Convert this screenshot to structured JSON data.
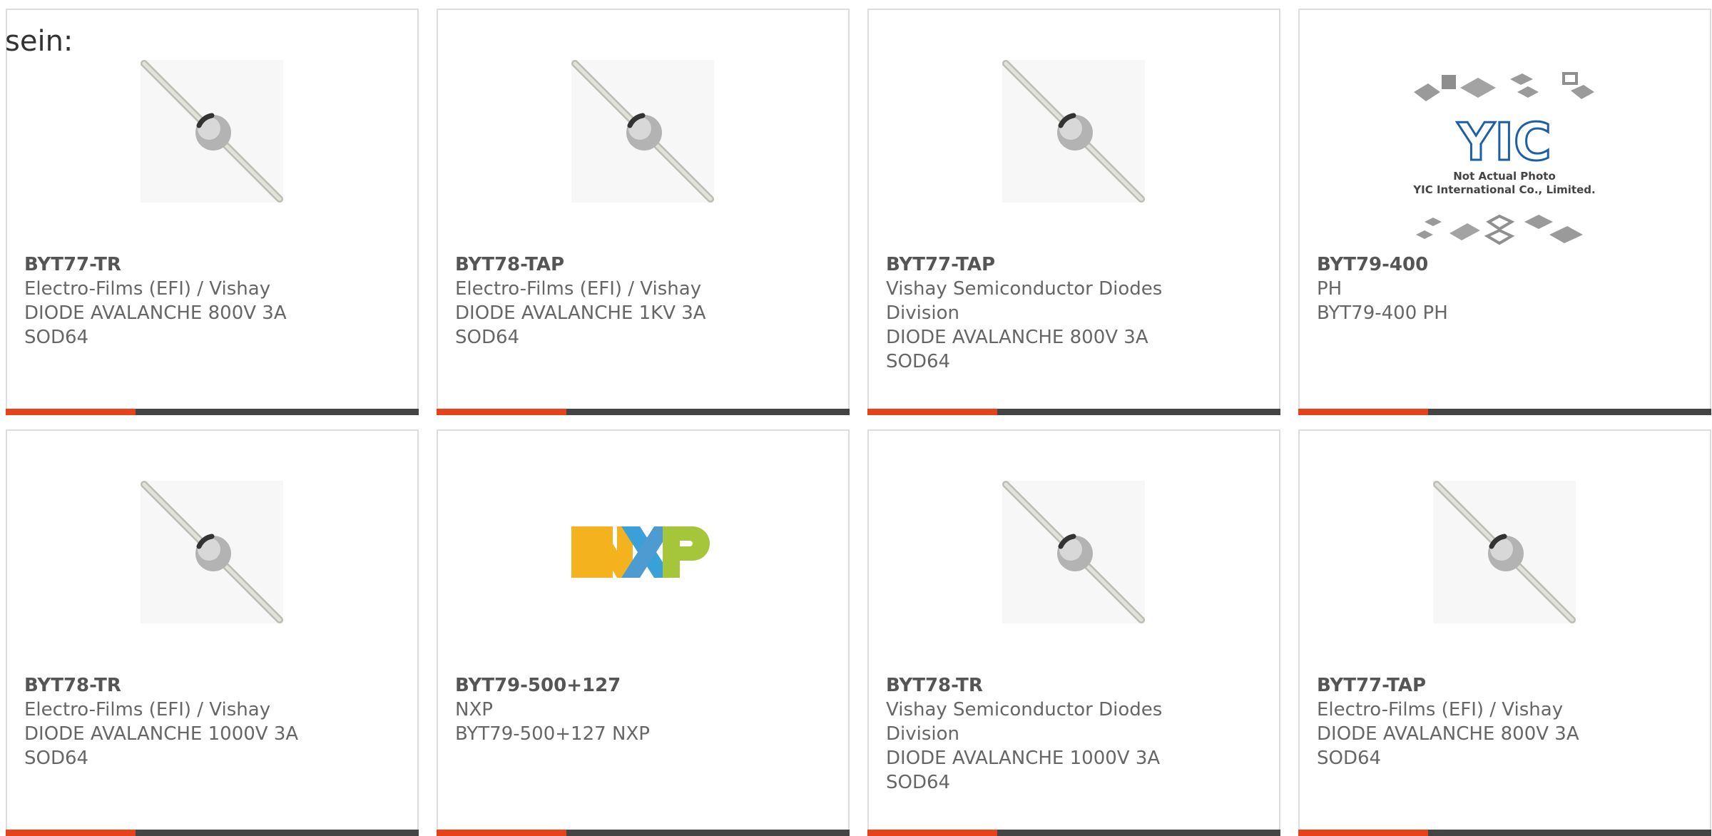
{
  "intro_text": "sein:",
  "products": [
    {
      "part": "BYT77-TR",
      "manufacturer": "Electro-Films (EFI) / Vishay",
      "description": [
        "DIODE AVALANCHE 800V 3A",
        "SOD64"
      ],
      "image": "diode-icon"
    },
    {
      "part": "BYT78-TAP",
      "manufacturer": "Electro-Films (EFI) / Vishay",
      "description": [
        "DIODE AVALANCHE 1KV 3A",
        "SOD64"
      ],
      "image": "diode-icon"
    },
    {
      "part": "BYT77-TAP",
      "manufacturer": "Vishay Semiconductor Diodes Division",
      "description": [
        "DIODE AVALANCHE 800V 3A",
        "SOD64"
      ],
      "image": "diode-icon"
    },
    {
      "part": "BYT79-400",
      "manufacturer": "PH",
      "description": [
        "BYT79-400 PH"
      ],
      "image": "yic-placeholder-logo",
      "logo_text": {
        "brand": "YIC",
        "line1": "Not Actual Photo",
        "line2": "YIC International Co., Limited."
      }
    },
    {
      "part": "BYT78-TR",
      "manufacturer": "Electro-Films (EFI) / Vishay",
      "description": [
        "DIODE AVALANCHE 1000V 3A",
        "SOD64"
      ],
      "image": "diode-icon"
    },
    {
      "part": "BYT79-500+127",
      "manufacturer": "NXP",
      "description": [
        "BYT79-500+127 NXP"
      ],
      "image": "nxp-logo",
      "logo_text": {
        "brand": "NXP"
      }
    },
    {
      "part": "BYT78-TR",
      "manufacturer": "Vishay Semiconductor Diodes Division",
      "description": [
        "DIODE AVALANCHE 1000V 3A",
        "SOD64"
      ],
      "image": "diode-icon"
    },
    {
      "part": "BYT77-TAP",
      "manufacturer": "Electro-Films (EFI) / Vishay",
      "description": [
        "DIODE AVALANCHE 800V 3A",
        "SOD64"
      ],
      "image": "diode-icon"
    }
  ],
  "colors": {
    "accent": "#e8421a",
    "bar": "#444444",
    "text": "#666666",
    "border": "#dddddd"
  }
}
